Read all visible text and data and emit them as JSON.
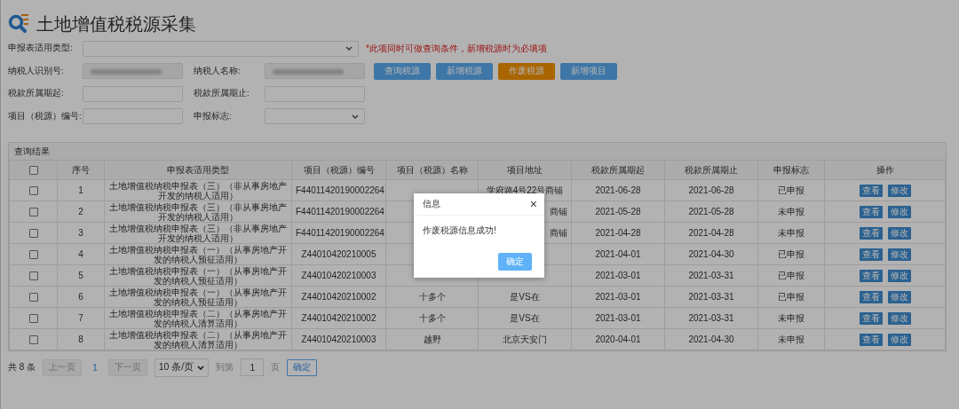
{
  "title": "土地增值税税源采集",
  "form": {
    "type_select": {
      "label": "申报表适用类型:",
      "note": "*此项同时可做查询条件，新增税源时为必填项"
    },
    "rows": [
      {
        "fields": [
          {
            "label": "纳税人识别号:",
            "kind": "text",
            "disabled": true,
            "redacted": true
          },
          {
            "label": "纳税人名称:",
            "kind": "text",
            "disabled": true,
            "redacted": true
          }
        ],
        "buttons": [
          {
            "label": "查询税源",
            "kind": "primary"
          },
          {
            "label": "新增税源",
            "kind": "primary"
          },
          {
            "label": "作废税源",
            "kind": "warning"
          },
          {
            "label": "新增项目",
            "kind": "primary"
          }
        ]
      },
      {
        "fields": [
          {
            "label": "税款所属期起:",
            "kind": "text",
            "disabled": false,
            "redacted": false
          },
          {
            "label": "税款所属期止:",
            "kind": "text",
            "disabled": false,
            "redacted": false
          }
        ],
        "buttons": []
      },
      {
        "fields": [
          {
            "label": "项目（税源）编号:",
            "kind": "text",
            "disabled": false,
            "redacted": false
          },
          {
            "label": "申报标志:",
            "kind": "select",
            "disabled": false,
            "redacted": false
          }
        ],
        "buttons": []
      }
    ]
  },
  "table": {
    "title": "查询结果",
    "header_checkbox": {
      "checked": false
    },
    "columns": [
      "序号",
      "申报表适用类型",
      "项目（税源）编号",
      "项目（税源）名称",
      "项目地址",
      "税款所属期起",
      "税款所属期止",
      "申报标志",
      "操作"
    ],
    "rows": [
      {
        "checked": false,
        "actions": [
          "查看",
          "修改"
        ],
        "cells": [
          "1",
          "土地增值税纳税申报表（三）（非从事房地产开发的纳税人适用）",
          "F44011420190002264",
          "",
          "学府路4号22号商铺",
          "2021-06-28",
          "2021-06-28",
          "已申报"
        ]
      },
      {
        "checked": false,
        "actions": [
          "查看",
          "修改"
        ],
        "cells": [
          "2",
          "土地增值税纳税申报表（三）（非从事房地产开发的纳税人适用）",
          "F44011420190002264",
          "",
          {
            "text": "商铺",
            "align_right": true
          },
          "2021-05-28",
          "2021-05-28",
          "未申报"
        ]
      },
      {
        "checked": false,
        "actions": [
          "查看",
          "修改"
        ],
        "cells": [
          "3",
          "土地增值税纳税申报表（三）（非从事房地产开发的纳税人适用）",
          "F44011420190002264",
          "",
          {
            "text": "商铺",
            "align_right": true
          },
          "2021-04-28",
          "2021-04-28",
          "未申报"
        ]
      },
      {
        "checked": false,
        "actions": [
          "查看",
          "修改"
        ],
        "cells": [
          "4",
          "土地增值税纳税申报表（一）（从事房地产开发的纳税人预征适用）",
          "Z44010420210005",
          "",
          "",
          "2021-04-01",
          "2021-04-30",
          "已申报"
        ]
      },
      {
        "checked": false,
        "actions": [
          "查看",
          "修改"
        ],
        "cells": [
          "5",
          "土地增值税纳税申报表（一）（从事房地产开发的纳税人预征适用）",
          "Z44010420210003",
          "",
          "",
          "2021-03-01",
          "2021-03-31",
          "已申报"
        ]
      },
      {
        "checked": false,
        "actions": [
          "查看",
          "修改"
        ],
        "cells": [
          "6",
          "土地增值税纳税申报表（一）（从事房地产开发的纳税人预征适用）",
          "Z44010420210002",
          "十多个",
          "是VS在",
          "2021-03-01",
          "2021-03-31",
          "已申报"
        ]
      },
      {
        "checked": false,
        "actions": [
          "查看",
          "修改"
        ],
        "cells": [
          "7",
          "土地增值税纳税申报表（二）（从事房地产开发的纳税人清算适用）",
          "Z44010420210002",
          "十多个",
          "是VS在",
          "2021-03-01",
          "2021-03-31",
          "未申报"
        ]
      },
      {
        "checked": false,
        "actions": [
          "查看",
          "修改"
        ],
        "cells": [
          "8",
          "土地增值税纳税申报表（二）（从事房地产开发的纳税人清算适用）",
          "Z44010420210003",
          "越野",
          "北京天安门",
          "2020-04-01",
          "2021-04-30",
          "未申报"
        ]
      }
    ]
  },
  "pagination": {
    "total": "共 8 条",
    "prev": {
      "label": "上一页",
      "disabled": true
    },
    "page": "1",
    "next": {
      "label": "下一页",
      "disabled": true
    },
    "page_size": "10 条/页",
    "goto_label": "到第",
    "goto_value": "1",
    "page_unit": "页",
    "confirm": "确定"
  },
  "dialog": {
    "title": "信息",
    "close": "×",
    "message": "作废税源信息成功!",
    "ok": "确定"
  }
}
